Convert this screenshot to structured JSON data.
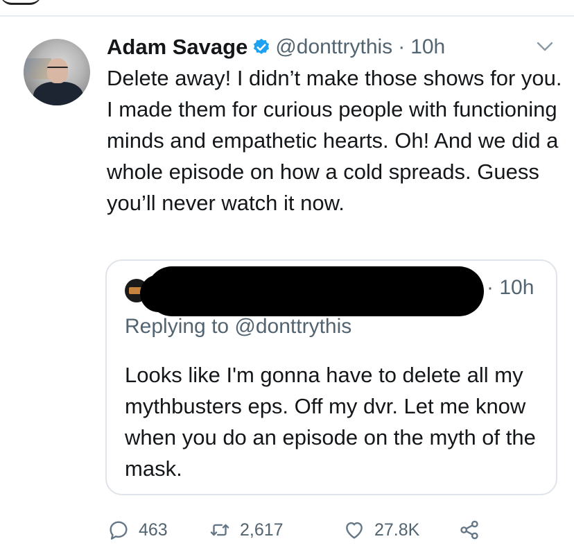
{
  "tweet": {
    "author_name": "Adam Savage",
    "handle": "@donttrythis",
    "separator": "·",
    "time": "10h",
    "text": "Delete away! I didn’t make those shows for you. I made them for curious people with functioning minds and empathetic hearts. Oh! And we did a whole episode on how a cold spreads. Guess you’ll never watch it now.",
    "verified": true,
    "accent_color": "#1da1f2"
  },
  "quoted_tweet": {
    "time": "· 10h",
    "replying_to": "Replying to @donttrythis",
    "text": "Looks like I'm gonna have to delete all my mythbusters eps. Off my dvr. Let me know when you do an episode on the myth of the mask."
  },
  "actions": {
    "replies": "463",
    "retweets": "2,617",
    "likes": "27.8K",
    "icons": [
      "reply-icon",
      "retweet-icon",
      "like-icon",
      "share-icon"
    ]
  }
}
